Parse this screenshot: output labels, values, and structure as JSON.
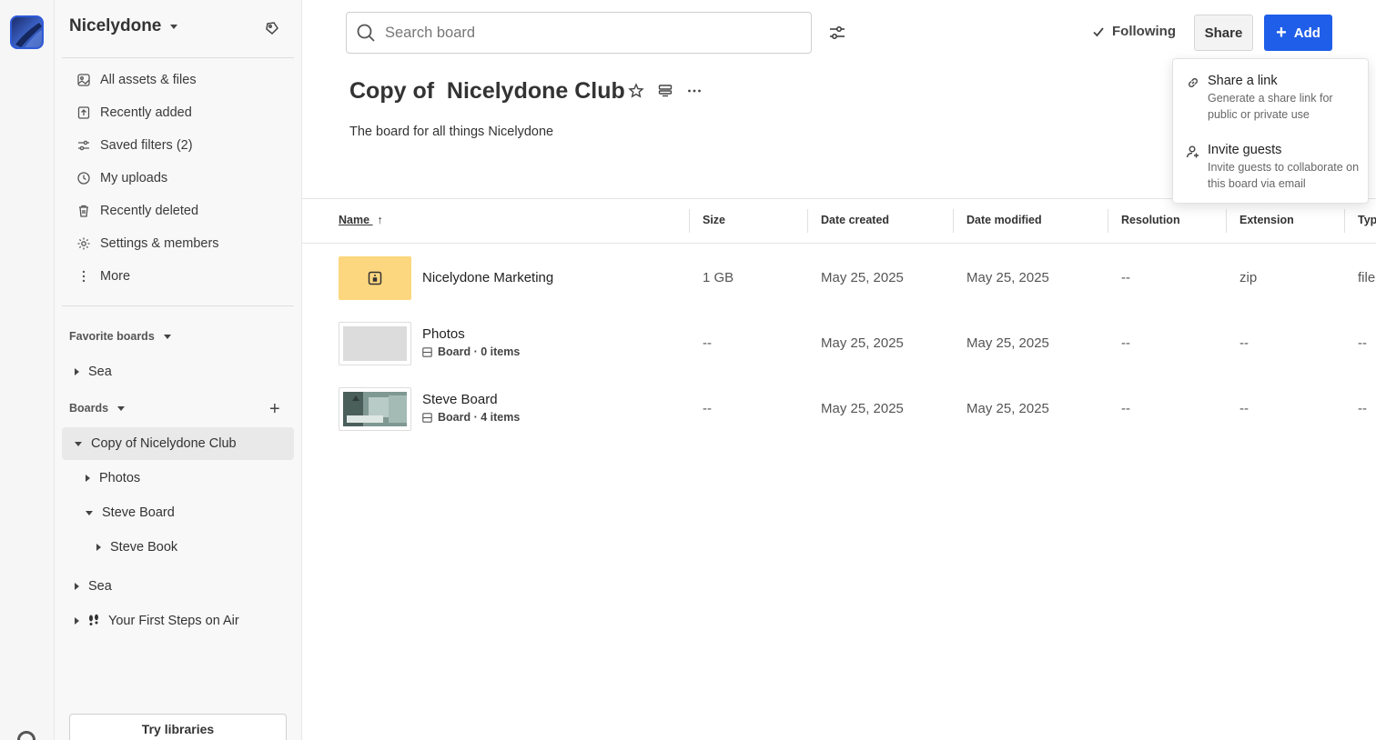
{
  "workspace": {
    "name": "Nicelydone"
  },
  "nav": {
    "items": [
      {
        "label": "All assets & files",
        "icon": "assets-icon"
      },
      {
        "label": "Recently added",
        "icon": "upload-icon"
      },
      {
        "label": "Saved filters (2)",
        "icon": "filter-icon"
      },
      {
        "label": "My uploads",
        "icon": "clock-icon"
      },
      {
        "label": "Recently deleted",
        "icon": "trash-icon"
      },
      {
        "label": "Settings & members",
        "icon": "gear-icon"
      },
      {
        "label": "More",
        "icon": "more-vertical-icon"
      }
    ]
  },
  "favorites": {
    "label": "Favorite boards",
    "items": [
      {
        "label": "Sea"
      }
    ]
  },
  "boards": {
    "label": "Boards",
    "tree": [
      {
        "label": "Copy of Nicelydone Club"
      },
      {
        "label": "Photos"
      },
      {
        "label": "Steve Board"
      },
      {
        "label": "Steve Book"
      },
      {
        "label": "Sea"
      },
      {
        "label": "Your First Steps on Air"
      }
    ]
  },
  "sidebar_footer": {
    "try_libraries": "Try libraries"
  },
  "search": {
    "placeholder": "Search board"
  },
  "header": {
    "following": "Following",
    "share": "Share",
    "add": "Add"
  },
  "board": {
    "title": "Copy of  Nicelydone Club",
    "description": "The board for all things Nicelydone"
  },
  "table": {
    "columns": [
      "Name",
      "Size",
      "Date created",
      "Date modified",
      "Resolution",
      "Extension",
      "Typ"
    ],
    "rows": [
      {
        "name": "Nicelydone Marketing",
        "sub": "",
        "size": "1 GB",
        "created": "May 25, 2025",
        "modified": "May 25, 2025",
        "resolution": "--",
        "extension": "zip",
        "type": "file"
      },
      {
        "name": "Photos",
        "sub": "Board · 0 items",
        "size": "--",
        "created": "May 25, 2025",
        "modified": "May 25, 2025",
        "resolution": "--",
        "extension": "--",
        "type": "--"
      },
      {
        "name": "Steve Board",
        "sub": "Board · 4 items",
        "size": "--",
        "created": "May 25, 2025",
        "modified": "May 25, 2025",
        "resolution": "--",
        "extension": "--",
        "type": "--"
      }
    ]
  },
  "share_menu": {
    "items": [
      {
        "title": "Share a link",
        "desc": "Generate a share link for public or private use",
        "icon": "link-icon"
      },
      {
        "title": "Invite guests",
        "desc": "Invite guests to collaborate on this board via email",
        "icon": "add-person-icon"
      }
    ]
  },
  "colors": {
    "accent": "#1f5ee8",
    "folder": "#fcd77f",
    "selected": "#e9e9e9"
  }
}
